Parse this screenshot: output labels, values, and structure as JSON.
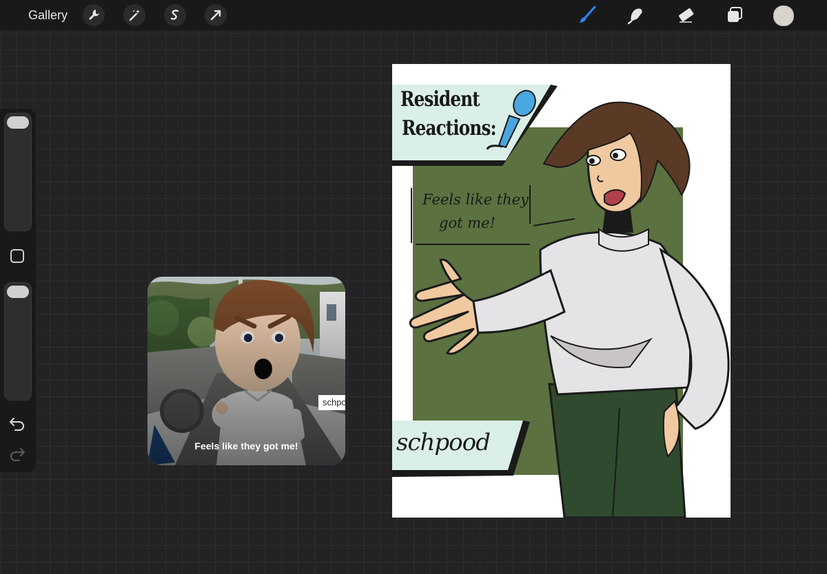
{
  "toolbar": {
    "gallery_label": "Gallery",
    "left_tools": [
      "wrench-icon",
      "magic-wand-icon",
      "selection-icon",
      "transform-arrow-icon"
    ],
    "right_tools": [
      "brush-icon",
      "smudge-icon",
      "eraser-icon",
      "layers-icon"
    ],
    "active_tool": "brush-icon",
    "current_color": "#d8d3cd",
    "accent_color": "#2f86ff"
  },
  "sidebar": {
    "controls": [
      "brush-size-slider",
      "modify-button",
      "opacity-slider",
      "undo-icon",
      "redo-icon"
    ]
  },
  "reference": {
    "caption": "Feels like they got me!",
    "name_tag": "schpo"
  },
  "artwork": {
    "title_line1": "Resident",
    "title_line2": "Reactions:",
    "speech_line1": "Feels like they",
    "speech_line2": "got me!",
    "name": "schpood",
    "colors": {
      "panel_green": "#5b7140",
      "banner_mint": "#d9efe8",
      "mic_blue": "#4aa6e0",
      "shirt": "#e4e3e6",
      "pants": "#2f4a2e",
      "hair": "#5a3a25",
      "skin": "#f0c9a0"
    }
  }
}
